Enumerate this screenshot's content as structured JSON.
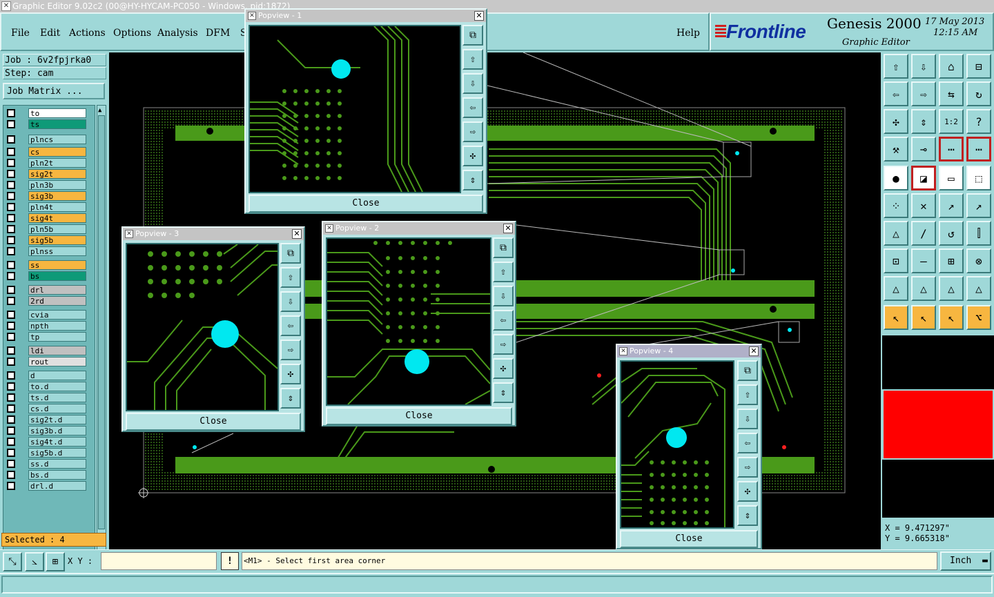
{
  "window": {
    "title": "Graphic Editor 9.02c2 (00@HY-HYCAM-PC050 - Windows, pid:1872)"
  },
  "menu": {
    "items": [
      "File",
      "Edit",
      "Actions",
      "Options",
      "Analysis",
      "DFM",
      "S"
    ],
    "help": "Help"
  },
  "brand": {
    "logo": "Frontline",
    "product": "Genesis 2000",
    "subtitle": "Graphic Editor",
    "date": "17 May 2013",
    "time": "12:15 AM"
  },
  "job": {
    "job_line": "Job : 6v2fpjrka0",
    "step_line": "Step: cam",
    "matrix_button": "Job Matrix ..."
  },
  "layers": [
    {
      "name": "to",
      "color": "#ffffff"
    },
    {
      "name": "ts",
      "color": "#0e9a78"
    },
    {
      "name": "plncs",
      "color": "#9fd8d8"
    },
    {
      "name": "cs",
      "color": "#f7b640"
    },
    {
      "name": "pln2t",
      "color": "#9fd8d8"
    },
    {
      "name": "sig2t",
      "color": "#f7b640"
    },
    {
      "name": "pln3b",
      "color": "#9fd8d8"
    },
    {
      "name": "sig3b",
      "color": "#f7b640"
    },
    {
      "name": "pln4t",
      "color": "#9fd8d8"
    },
    {
      "name": "sig4t",
      "color": "#f7b640"
    },
    {
      "name": "pln5b",
      "color": "#9fd8d8"
    },
    {
      "name": "sig5b",
      "color": "#f7b640"
    },
    {
      "name": "plnss",
      "color": "#9fd8d8"
    },
    {
      "name": "ss",
      "color": "#f7b640"
    },
    {
      "name": "bs",
      "color": "#0e9a78"
    },
    {
      "name": "drl",
      "color": "#c0c0c0"
    },
    {
      "name": "2rd",
      "color": "#c0c0c0"
    },
    {
      "name": "cvia",
      "color": "#9fd8d8"
    },
    {
      "name": "npth",
      "color": "#9fd8d8"
    },
    {
      "name": "tp",
      "color": "#9fd8d8"
    },
    {
      "name": "ldi",
      "color": "#c0c0c0"
    },
    {
      "name": "rout",
      "color": "#e0e0e0"
    },
    {
      "name": "d",
      "color": "#9fd8d8"
    },
    {
      "name": "to.d",
      "color": "#9fd8d8"
    },
    {
      "name": "ts.d",
      "color": "#9fd8d8"
    },
    {
      "name": "cs.d",
      "color": "#9fd8d8"
    },
    {
      "name": "sig2t.d",
      "color": "#9fd8d8"
    },
    {
      "name": "sig3b.d",
      "color": "#9fd8d8"
    },
    {
      "name": "sig4t.d",
      "color": "#9fd8d8"
    },
    {
      "name": "sig5b.d",
      "color": "#9fd8d8"
    },
    {
      "name": "ss.d",
      "color": "#9fd8d8"
    },
    {
      "name": "bs.d",
      "color": "#9fd8d8"
    },
    {
      "name": "drl.d",
      "color": "#9fd8d8"
    }
  ],
  "selected_status": "Selected : 4",
  "popviews": [
    {
      "title": "Popview - 1",
      "close": "Close",
      "x_glyph": "✕"
    },
    {
      "title": "Popview - 3",
      "close": "Close",
      "x_glyph": "✕"
    },
    {
      "title": "Popview - 2",
      "close": "Close",
      "x_glyph": "✕"
    },
    {
      "title": "Popview - 4",
      "close": "Close",
      "x_glyph": "✕"
    }
  ],
  "colors": {
    "trace": "#4a9a1a",
    "pad": "#00e8f0",
    "highlight_layer": "#f7b640",
    "red_marker": "#ff0000"
  },
  "coords": {
    "x": "X = 9.471297\"",
    "y": "Y = 9.665318\""
  },
  "bottom": {
    "xy_label": "X Y :",
    "xy_value": "",
    "warn": "!",
    "prompt": "<M1> - Select first area corner",
    "unit": "Inch"
  },
  "icons": {
    "pv_tools": [
      "zoom-fit-icon",
      "pan-up-icon",
      "pan-down-icon",
      "pan-left-icon",
      "pan-right-icon",
      "zoom-out-icon",
      "zoom-in-icon"
    ],
    "right_tools": [
      "zoom-up-icon",
      "zoom-down-icon",
      "home-icon",
      "window-icon",
      "pan-left-icon",
      "pan-right-icon",
      "mirror-icon",
      "rotate-icon",
      "zoom-extents-icon",
      "zoom-center-icon",
      "scale-1-2-icon",
      "help-icon"
    ]
  }
}
